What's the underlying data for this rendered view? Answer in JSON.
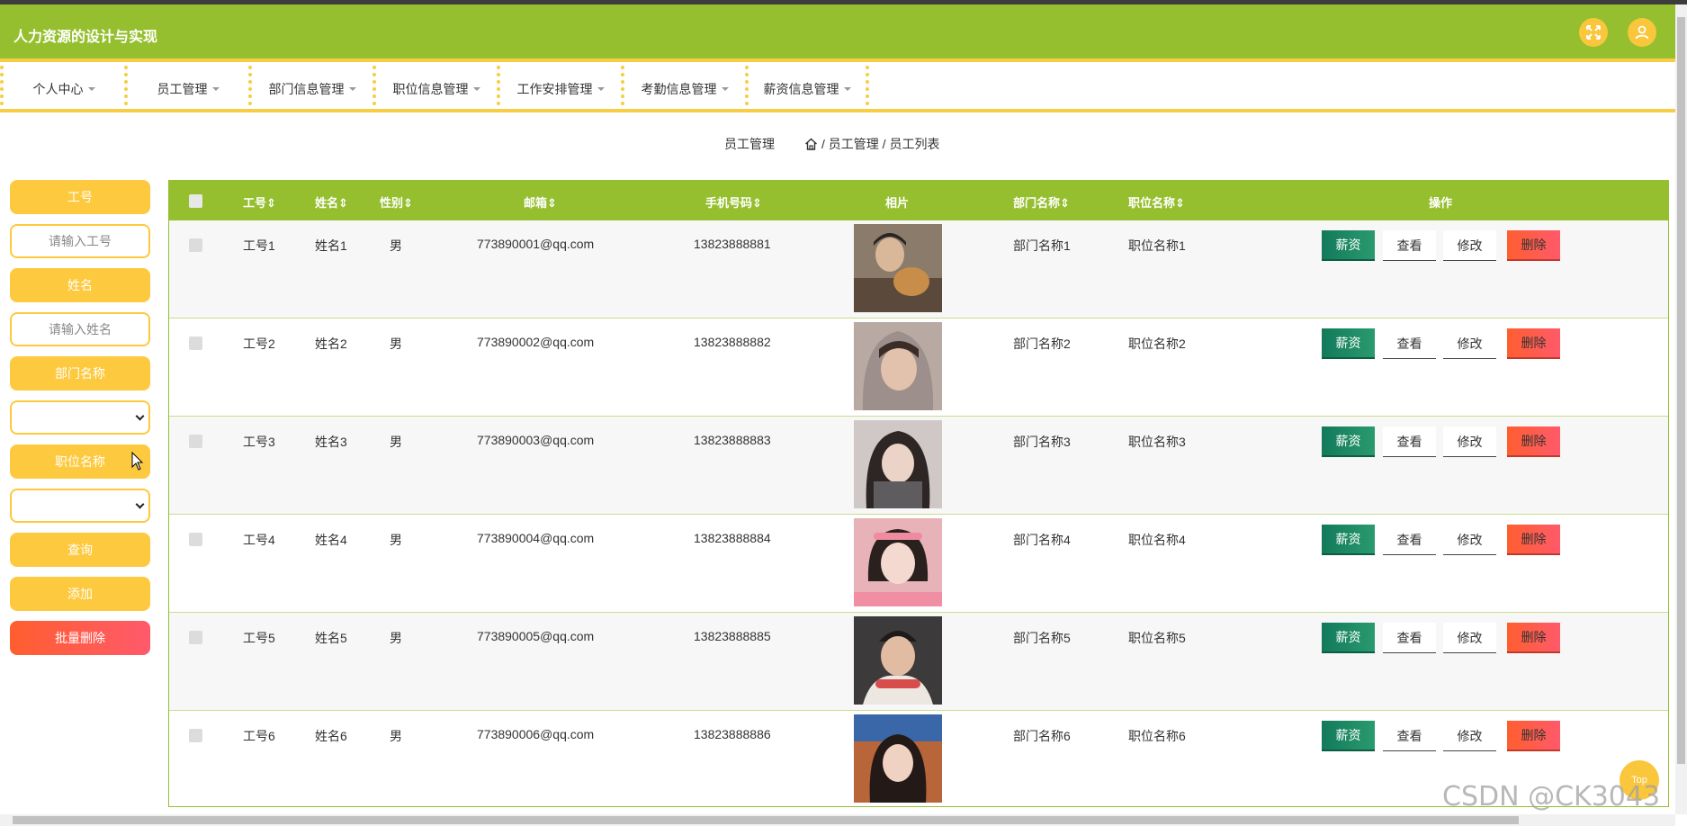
{
  "app": {
    "title": "人力资源的设计与实现"
  },
  "header_icons": {
    "fullscreen": "expand-icon",
    "user": "user-icon"
  },
  "colors": {
    "header": "#95bf2e",
    "accent": "#fdc93e",
    "danger": "#ff5a4a",
    "pay": "#127a5a"
  },
  "nav": {
    "items": [
      {
        "label": "个人中心"
      },
      {
        "label": "员工管理"
      },
      {
        "label": "部门信息管理"
      },
      {
        "label": "职位信息管理"
      },
      {
        "label": "工作安排管理"
      },
      {
        "label": "考勤信息管理"
      },
      {
        "label": "薪资信息管理"
      }
    ]
  },
  "breadcrumb": {
    "page": "员工管理",
    "path": "/ 员工管理 / 员工列表"
  },
  "search": {
    "emp_no_label": "工号",
    "emp_no_placeholder": "请输入工号",
    "name_label": "姓名",
    "name_placeholder": "请输入姓名",
    "dept_label": "部门名称",
    "dept_value": "",
    "position_label": "职位名称",
    "position_value": "",
    "query_button": "查询",
    "add_button": "添加",
    "batch_delete_button": "批量删除"
  },
  "table": {
    "headers": {
      "emp_no": "工号",
      "name": "姓名",
      "gender": "性别",
      "email": "邮箱",
      "phone": "手机号码",
      "photo": "相片",
      "dept": "部门名称",
      "position": "职位名称",
      "actions": "操作"
    },
    "action_labels": {
      "pay": "薪资",
      "view": "查看",
      "edit": "修改",
      "delete": "删除"
    },
    "rows": [
      {
        "emp_no": "工号1",
        "name": "姓名1",
        "gender": "男",
        "email": "773890001@qq.com",
        "phone": "13823888881",
        "dept": "部门名称1",
        "position": "职位名称1"
      },
      {
        "emp_no": "工号2",
        "name": "姓名2",
        "gender": "男",
        "email": "773890002@qq.com",
        "phone": "13823888882",
        "dept": "部门名称2",
        "position": "职位名称2"
      },
      {
        "emp_no": "工号3",
        "name": "姓名3",
        "gender": "男",
        "email": "773890003@qq.com",
        "phone": "13823888883",
        "dept": "部门名称3",
        "position": "职位名称3"
      },
      {
        "emp_no": "工号4",
        "name": "姓名4",
        "gender": "男",
        "email": "773890004@qq.com",
        "phone": "13823888884",
        "dept": "部门名称4",
        "position": "职位名称4"
      },
      {
        "emp_no": "工号5",
        "name": "姓名5",
        "gender": "男",
        "email": "773890005@qq.com",
        "phone": "13823888885",
        "dept": "部门名称5",
        "position": "职位名称5"
      },
      {
        "emp_no": "工号6",
        "name": "姓名6",
        "gender": "男",
        "email": "773890006@qq.com",
        "phone": "13823888886",
        "dept": "部门名称6",
        "position": "职位名称6"
      }
    ]
  },
  "back_to_top": "Top",
  "watermark": "CSDN @CK3043"
}
